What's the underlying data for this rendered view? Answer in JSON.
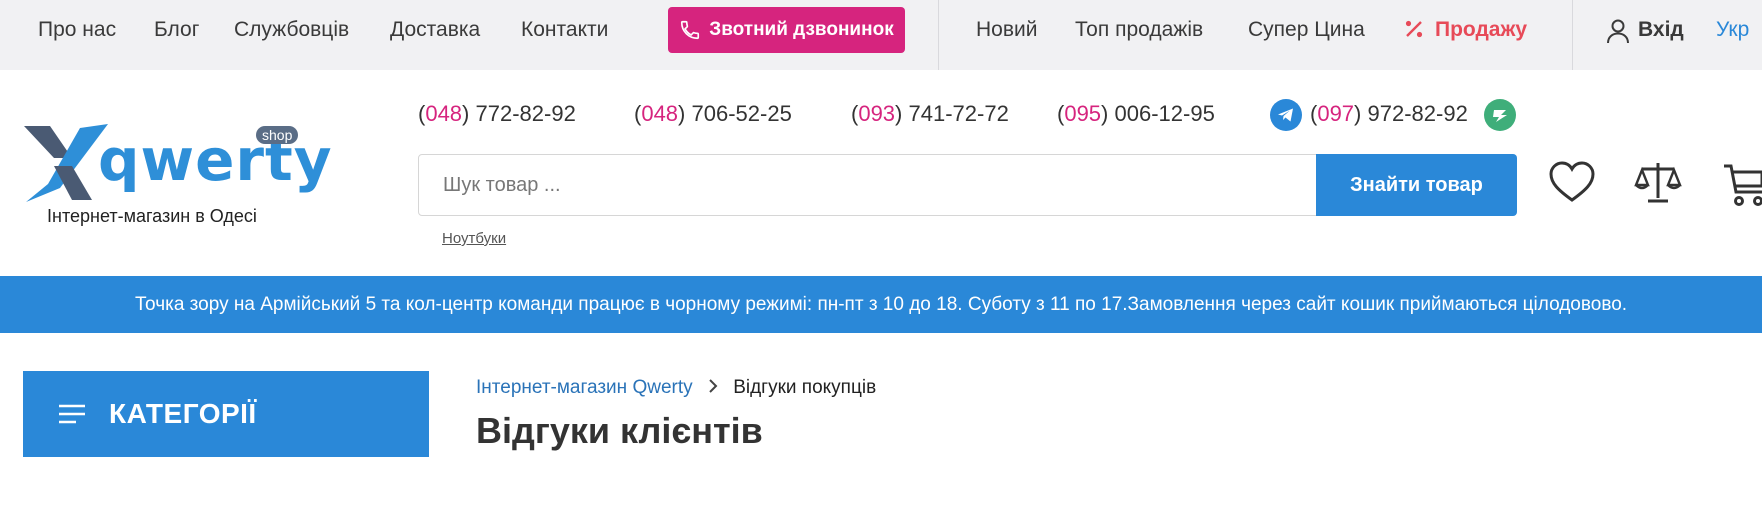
{
  "topnav": {
    "links": [
      "Про нас",
      "Блог",
      "Службовців",
      "Доставка",
      "Контакти"
    ],
    "callback": "Звотний дзвонинок",
    "links2": [
      "Новий",
      "Топ продажів",
      "Супер Цина"
    ],
    "sale": "Продажу",
    "login": "Вхід",
    "lang": "Укр"
  },
  "logo": {
    "word": "qwerty",
    "badge": "shop",
    "tagline": "Інтернет-магазин в Одесі"
  },
  "phones": [
    {
      "code": "048",
      "number": "772-82-92"
    },
    {
      "code": "048",
      "number": "706-52-25"
    },
    {
      "code": "093",
      "number": "741-72-72"
    },
    {
      "code": "095",
      "number": "006-12-95"
    },
    {
      "code": "097",
      "number": "972-82-92"
    }
  ],
  "search": {
    "placeholder": "Шук товар ...",
    "button": "Знайти товар",
    "hint": "Ноутбуки"
  },
  "banner": {
    "text": "Точка зору на Армійський 5 та кол-центр команди працює в чорному режимі: пн-пт з 10 до 18. Суботу з 11 по 17.Замовлення через сайт кошик приймаються цілодовово."
  },
  "categories": {
    "label": "КАТЕГОРІЇ"
  },
  "breadcrumb": {
    "home": "Інтернет-магазин Qwerty",
    "current": "Відгуки покупців"
  },
  "page": {
    "title": "Відгуки клієнтів"
  },
  "colors": {
    "accent": "#2a88d8",
    "pink": "#d6247e",
    "sale": "#e74a58"
  }
}
